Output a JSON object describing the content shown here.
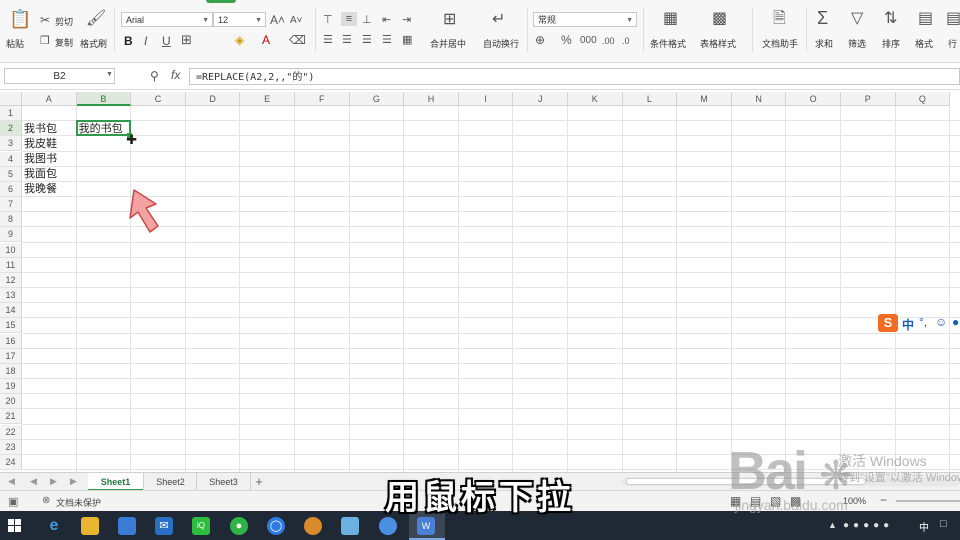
{
  "ribbon": {
    "paste": "粘贴",
    "cut": "剪切",
    "copy": "复制",
    "format_painter": "格式刷",
    "font_name": "Arial",
    "font_size": "12",
    "merge_center": "合并居中",
    "wrap_text": "自动换行",
    "number_format": "常规",
    "conditional_format": "条件格式",
    "table_style": "表格样式",
    "doc_helper": "文档助手",
    "sum": "求和",
    "filter": "筛选",
    "sort": "排序",
    "format": "格式",
    "rows_cols": "行"
  },
  "formula_bar": {
    "cell_ref": "B2",
    "fx": "fx",
    "formula": "=REPLACE(A2,2,,\"的\")"
  },
  "grid": {
    "columns": [
      "A",
      "B",
      "C",
      "D",
      "E",
      "F",
      "G",
      "H",
      "I",
      "J",
      "K",
      "L",
      "M",
      "N",
      "O",
      "P",
      "Q"
    ],
    "rows": [
      "1",
      "2",
      "3",
      "4",
      "5",
      "6",
      "7",
      "8",
      "9",
      "10",
      "11",
      "12",
      "13",
      "14",
      "15",
      "16",
      "17",
      "18",
      "19",
      "20",
      "21",
      "22",
      "23",
      "24"
    ],
    "cells": {
      "A2": "我书包",
      "A3": "我皮鞋",
      "A4": "我图书",
      "A5": "我面包",
      "A6": "我晚餐",
      "B2": "我的书包"
    },
    "selected": "B2"
  },
  "sheets": {
    "tabs": [
      "Sheet1",
      "Sheet2",
      "Sheet3"
    ],
    "add": "+"
  },
  "status": {
    "protect": "文档未保护",
    "zoom": "100%"
  },
  "ime": {
    "lang": "中"
  },
  "overlay": {
    "subtitle": "用鼠标下拉",
    "watermark_baidu": "Bai",
    "watermark_jingyan": "jingyan.baidu.com",
    "watermark_windows": "激活 Windows",
    "watermark_windows2": "转到\"设置\"以激活 Windows"
  }
}
